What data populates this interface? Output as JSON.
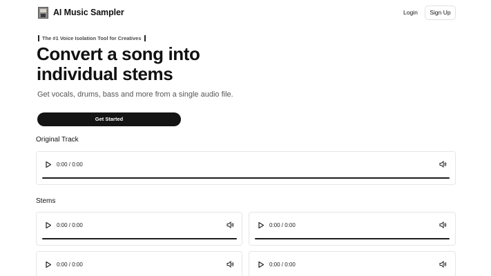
{
  "header": {
    "title": "AI Music Sampler",
    "login_label": "Login",
    "signup_label": "Sign Up"
  },
  "hero": {
    "tagline": "The #1 Voice Isolation Tool for Creatives",
    "title": "Convert a song into individual stems",
    "subtitle": "Get vocals, drums, bass and more from a single audio file.",
    "cta_label": "Get Started"
  },
  "original": {
    "label": "Original Track",
    "time": "0:00 / 0:00"
  },
  "stems": {
    "label": "Stems",
    "players": [
      {
        "time": "0:00 / 0:00"
      },
      {
        "time": "0:00 / 0:00"
      },
      {
        "time": "0:00 / 0:00"
      },
      {
        "time": "0:00 / 0:00"
      }
    ]
  },
  "colors": {
    "primary": "#141414",
    "border": "#e6e6e6",
    "text_muted": "#555555"
  },
  "icons": [
    "logo-icon",
    "play-icon",
    "volume-icon"
  ]
}
